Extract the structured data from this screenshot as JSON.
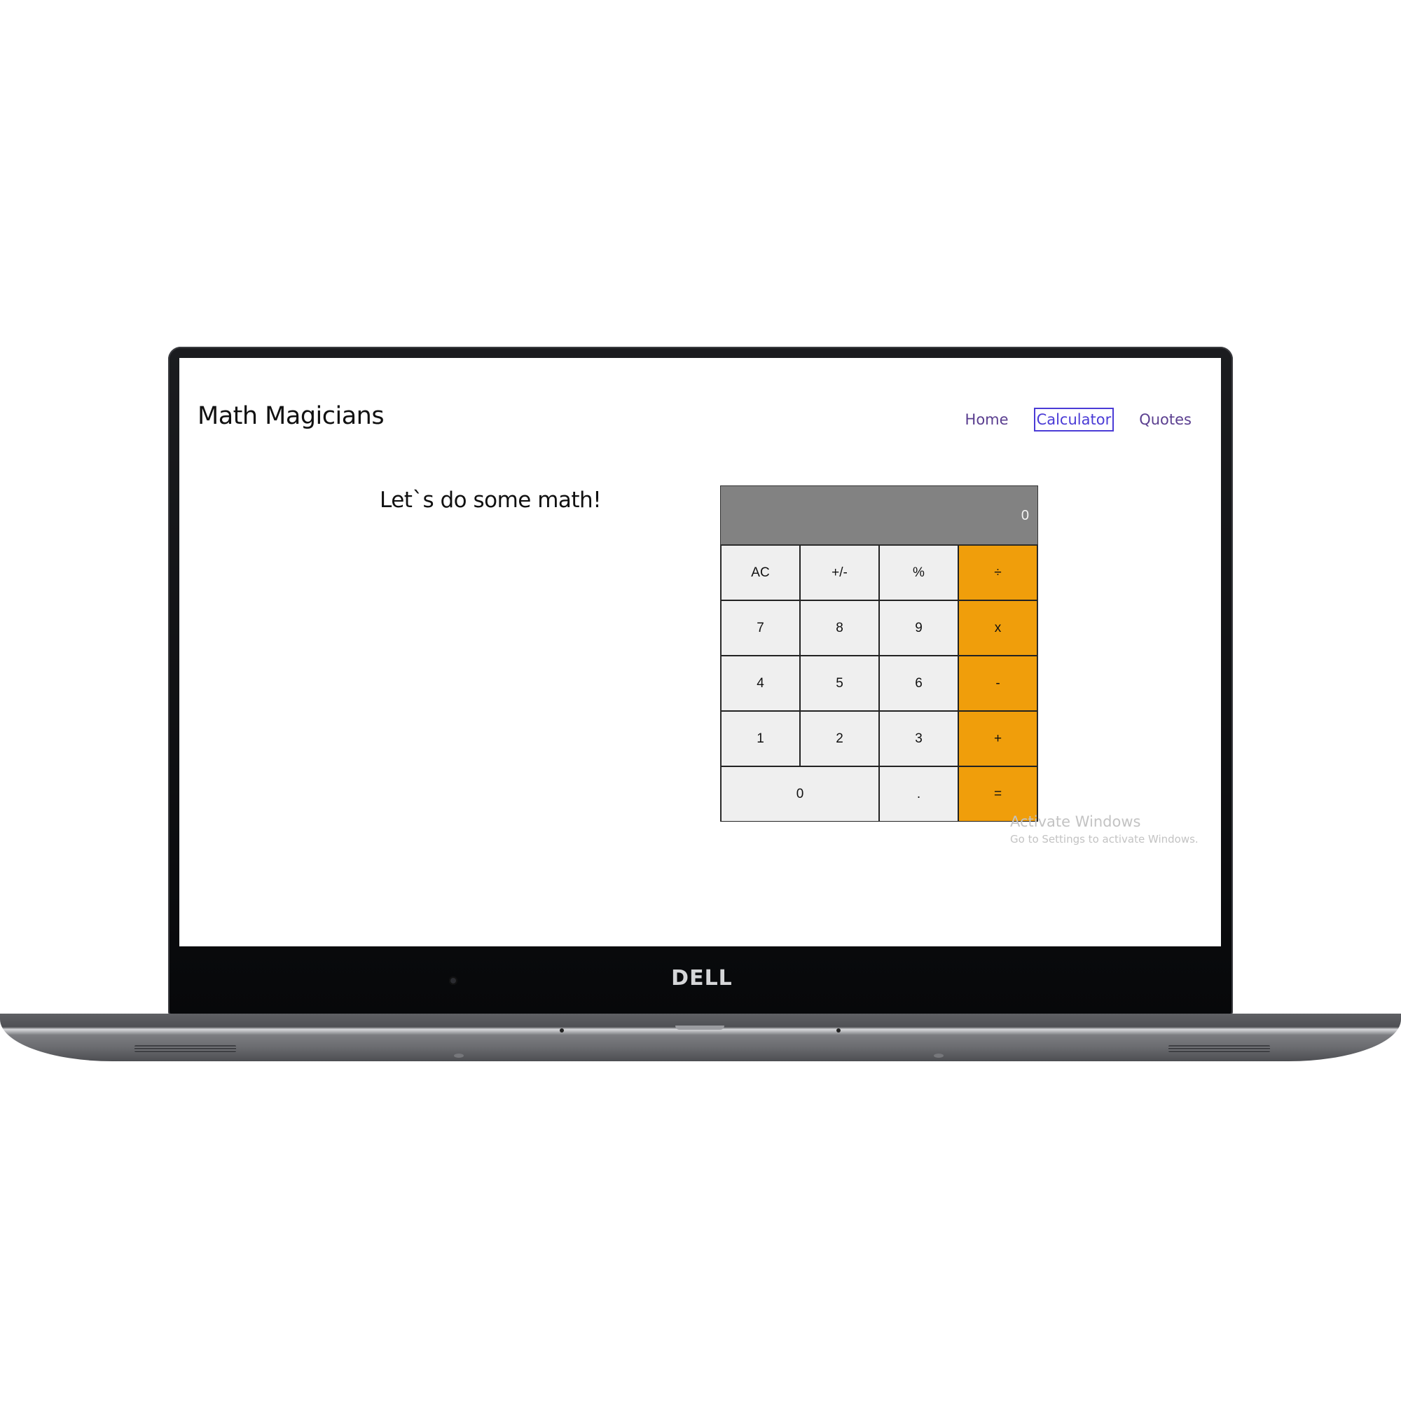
{
  "device": {
    "brand_logo": "DELL"
  },
  "app": {
    "title": "Math Magicians",
    "nav": {
      "home": "Home",
      "calculator": "Calculator",
      "quotes": "Quotes",
      "active": "Calculator"
    },
    "headline": "Let`s do some math!"
  },
  "calculator": {
    "display": "0",
    "keys": {
      "ac": "AC",
      "plus_minus": "+/-",
      "percent": "%",
      "divide": "÷",
      "seven": "7",
      "eight": "8",
      "nine": "9",
      "multiply": "x",
      "four": "4",
      "five": "5",
      "six": "6",
      "minus": "-",
      "one": "1",
      "two": "2",
      "three": "3",
      "plus": "+",
      "zero": "0",
      "decimal": ".",
      "equals": "="
    },
    "colors": {
      "operator": "#f09e0b",
      "display_bg": "#828282",
      "key_bg": "#efefef"
    }
  },
  "os_watermark": {
    "title": "Activate Windows",
    "subtitle": "Go to Settings to activate Windows."
  }
}
